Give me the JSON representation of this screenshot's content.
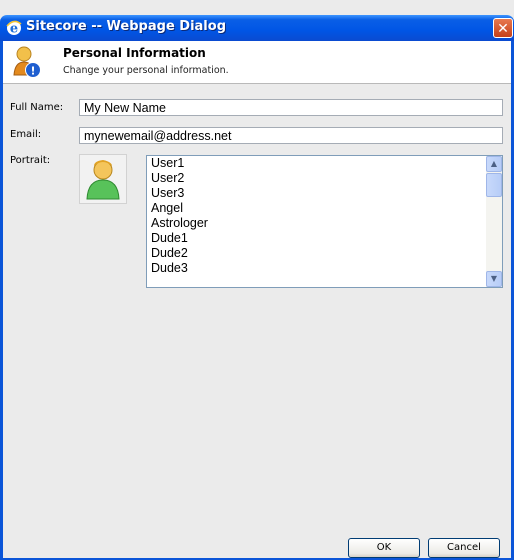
{
  "window": {
    "title": "Sitecore -- Webpage Dialog",
    "close_glyph": "✕"
  },
  "header": {
    "title": "Personal Information",
    "subtitle": "Change your personal information.",
    "icon": "user-info-icon"
  },
  "form": {
    "full_name_label": "Full Name:",
    "full_name_value": "My New Name",
    "email_label": "Email:",
    "email_value": "mynewemail@address.net",
    "portrait_label": "Portrait:"
  },
  "portrait_list": {
    "items": [
      "User1",
      "User2",
      "User3",
      "Angel",
      "Astrologer",
      "Dude1",
      "Dude2",
      "Dude3"
    ],
    "up_glyph": "▲",
    "down_glyph": "▼"
  },
  "buttons": {
    "ok": "OK",
    "cancel": "Cancel"
  },
  "colors": {
    "titlebar": "#0055e5",
    "body": "#ebebeb",
    "accent_close": "#c5401a"
  }
}
